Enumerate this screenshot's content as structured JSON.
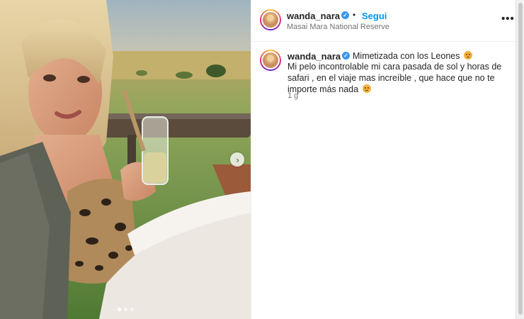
{
  "post": {
    "username": "wanda_nara",
    "follow_label": "Segui",
    "bullet": "•",
    "location": "Masai Mara National Reserve",
    "more_label": "•••"
  },
  "caption": {
    "username": "wanda_nara",
    "title": "Mimetizada con los Leones",
    "body": "Mi pelo incontrolable mi cara pasada de sol y horas de safari , en el viaje mas increíble , que hace que no te importe más nada",
    "time": "1 g"
  },
  "carousel": {
    "next_icon": "chevron-right-icon",
    "total_slides": 3,
    "active_slide": 1
  },
  "icons": {
    "verified": "verified-badge-icon",
    "emoji": "lion-emoji-icon"
  },
  "colors": {
    "follow": "#0095f6",
    "verified": "#3897f0",
    "text": "#262626",
    "muted": "#737373"
  }
}
